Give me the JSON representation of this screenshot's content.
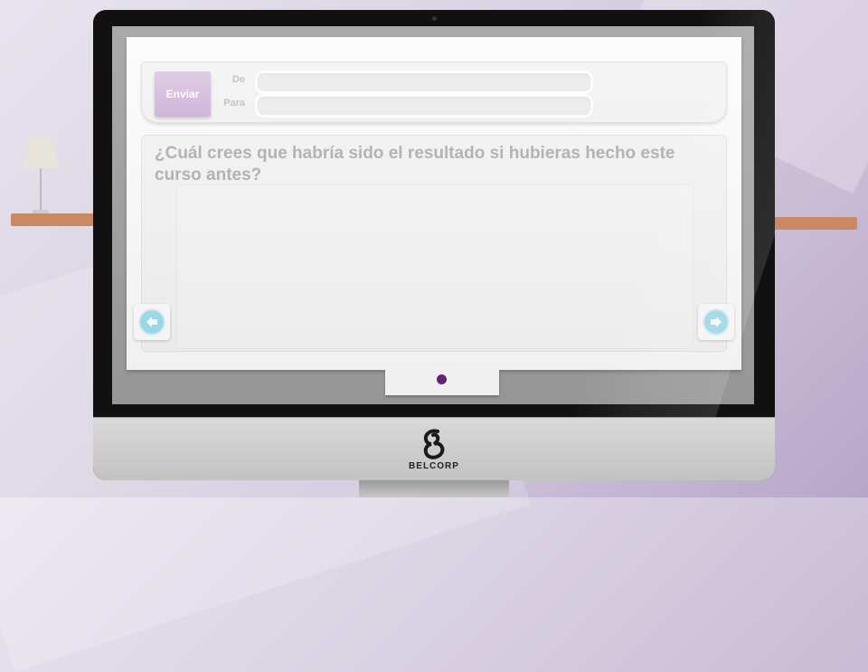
{
  "form": {
    "send_label": "Enviar",
    "from_label": "De",
    "to_label": "Para",
    "from_value": "",
    "to_value": ""
  },
  "question": {
    "text": "¿Cuál crees que habría sido el resultado si hubieras hecho este curso antes?"
  },
  "answer": {
    "value": ""
  },
  "navigation": {
    "prev_icon": "arrow-left-icon",
    "next_icon": "arrow-right-icon",
    "pages": 1,
    "current_page": 1
  },
  "brand": {
    "name": "BELCORP"
  },
  "colors": {
    "accent": "#6a2278",
    "send_button": "#d4bde0",
    "nav_button": "#9fe0ef",
    "question_text": "#b0b0b0"
  }
}
